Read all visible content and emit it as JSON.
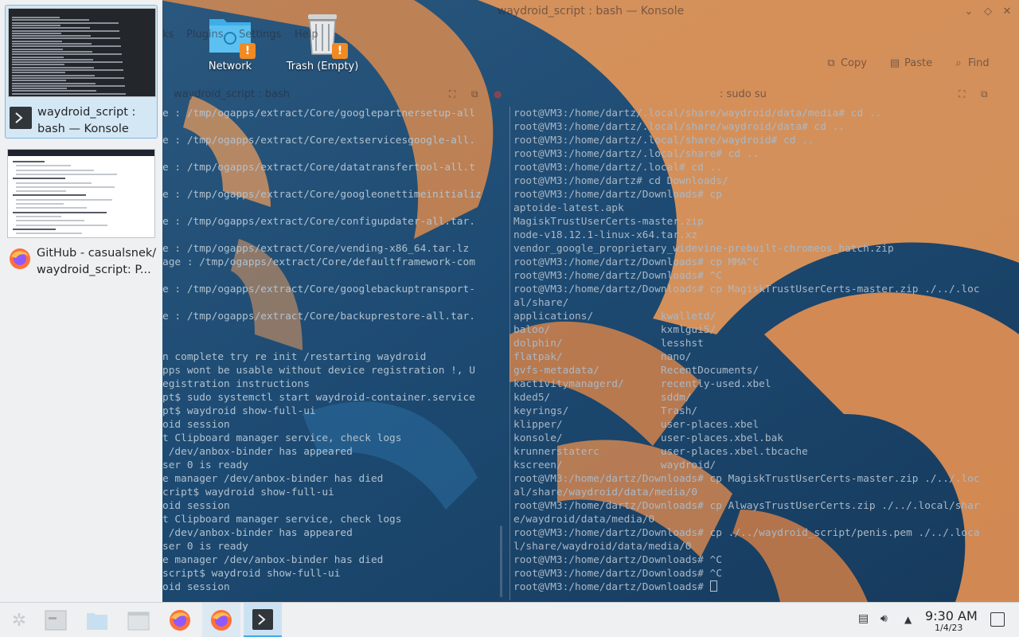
{
  "window": {
    "title": "waydroid_script : bash — Konsole",
    "menu": [
      "ks",
      "Plugins",
      "Settings",
      "Help"
    ],
    "toolbar": {
      "copy": "Copy",
      "paste": "Paste",
      "find": "Find"
    },
    "tab_left_title": "waydroid_script : bash",
    "tab_right_title": ": sudo su"
  },
  "desktop_icons": [
    {
      "label": "Network",
      "icon": "folder-network-icon"
    },
    {
      "label": "Trash (Empty)",
      "icon": "trash-icon"
    }
  ],
  "switcher": {
    "items": [
      {
        "label": "waydroid_script :\nbash — Konsole",
        "icon": "konsole-icon",
        "selected": true
      },
      {
        "label": "GitHub - casualsnek/\nwaydroid_script: P...",
        "icon": "firefox-icon",
        "selected": false
      }
    ]
  },
  "terminal_left": [
    "e : /tmp/ogapps/extract/Core/googlepartnersetup-all",
    "",
    "e : /tmp/ogapps/extract/Core/extservicesgoogle-all.",
    "",
    "e : /tmp/ogapps/extract/Core/datatransfertool-all.t",
    "",
    "e : /tmp/ogapps/extract/Core/googleonettimeinitializ",
    "",
    "e : /tmp/ogapps/extract/Core/configupdater-all.tar.",
    "",
    "e : /tmp/ogapps/extract/Core/vending-x86_64.tar.lz",
    "age : /tmp/ogapps/extract/Core/defaultframework-com",
    "",
    "e : /tmp/ogapps/extract/Core/googlebackuptransport-",
    "",
    "e : /tmp/ogapps/extract/Core/backuprestore-all.tar.",
    "",
    "",
    "n complete try re init /restarting waydroid",
    "pps wont be usable without device registration !, U",
    "egistration instructions",
    "pt$ sudo systemctl start waydroid-container.service",
    "pt$ waydroid show-full-ui",
    "oid session",
    "t Clipboard manager service, check logs",
    " /dev/anbox-binder has appeared",
    "ser 0 is ready",
    "e manager /dev/anbox-binder has died",
    "cript$ waydroid show-full-ui",
    "oid session",
    "t Clipboard manager service, check logs",
    " /dev/anbox-binder has appeared",
    "ser 0 is ready",
    "e manager /dev/anbox-binder has died",
    "script$ waydroid show-full-ui",
    "oid session"
  ],
  "terminal_right": [
    "root@VM3:/home/dartz/.local/share/waydroid/data/media# cd ..",
    "root@VM3:/home/dartz/.local/share/waydroid/data# cd ..",
    "root@VM3:/home/dartz/.local/share/waydroid# cd ..",
    "root@VM3:/home/dartz/.local/share# cd ..",
    "root@VM3:/home/dartz/.local# cd ..",
    "root@VM3:/home/dartz# cd Downloads/",
    "root@VM3:/home/dartz/Downloads# cp",
    "aptoide-latest.apk",
    "MagiskTrustUserCerts-master.zip",
    "node-v18.12.1-linux-x64.tar.xz",
    "vendor_google_proprietary_widevine-prebuilt-chromeos_hatch.zip",
    "root@VM3:/home/dartz/Downloads# cp MMA^C",
    "root@VM3:/home/dartz/Downloads# ^C",
    "root@VM3:/home/dartz/Downloads# cp MagiskTrustUserCerts-master.zip ./../.loc",
    "al/share/",
    "applications/           kwalletd/",
    "baloo/                  kxmlgui5/",
    "dolphin/                lesshst",
    "flatpak/                nano/",
    "gvfs-metadata/          RecentDocuments/",
    "kactivitymanagerd/      recently-used.xbel",
    "kded5/                  sddm/",
    "keyrings/               Trash/",
    "klipper/                user-places.xbel",
    "konsole/                user-places.xbel.bak",
    "krunnerstaterc          user-places.xbel.tbcache",
    "kscreen/                waydroid/",
    "root@VM3:/home/dartz/Downloads# cp MagiskTrustUserCerts-master.zip ./../.loc",
    "al/share/waydroid/data/media/0",
    "root@VM3:/home/dartz/Downloads# cp AlwaysTrustUserCerts.zip ./../.local/shar",
    "e/waydroid/data/media/0",
    "root@VM3:/home/dartz/Downloads# cp ./../waydroid_script/penis.pem ./../.loca",
    "l/share/waydroid/data/media/0",
    "root@VM3:/home/dartz/Downloads# ^C",
    "root@VM3:/home/dartz/Downloads# ^C",
    "root@VM3:/home/dartz/Downloads# "
  ],
  "taskbar": {
    "apps": [
      {
        "name": "kickoff",
        "icon": "app-launcher-icon"
      },
      {
        "name": "task-manager",
        "icon": "window-icon"
      },
      {
        "name": "files",
        "icon": "folder-icon"
      },
      {
        "name": "dolphin",
        "icon": "file-manager-icon"
      },
      {
        "name": "firefox",
        "icon": "firefox-icon"
      },
      {
        "name": "firefox-active",
        "icon": "firefox-icon"
      },
      {
        "name": "konsole-active",
        "icon": "konsole-icon"
      }
    ],
    "time": "9:30 AM",
    "date": "1/4/23"
  },
  "colors": {
    "accent": "#3daee9",
    "panel": "#eff0f1",
    "wallpaper_orange": "#e8945a",
    "wallpaper_blue": "#1f5a86"
  }
}
